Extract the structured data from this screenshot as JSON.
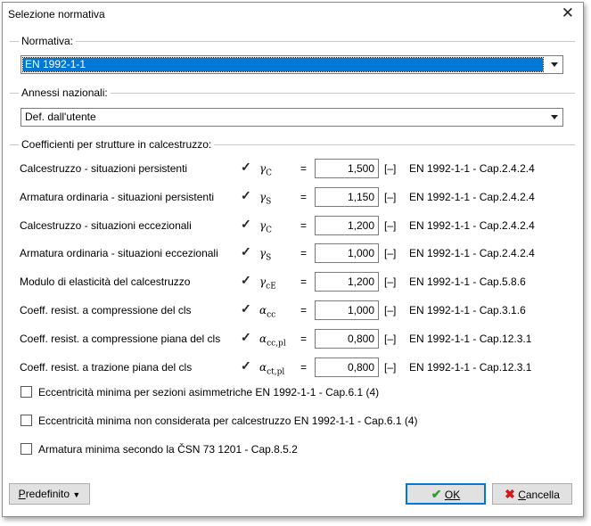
{
  "window": {
    "title": "Selezione normativa"
  },
  "normativa": {
    "label": "Normativa:",
    "value": "EN 1992-1-1"
  },
  "annessi": {
    "label": "Annessi nazionali:",
    "value": "Def. dall'utente"
  },
  "coeff": {
    "label": "Coefficienti per strutture in calcestruzzo:",
    "rows": [
      {
        "name": "Calcestruzzo - situazioni persistenti",
        "checked": true,
        "symbol": "γ",
        "sub": "C",
        "eq": "=",
        "value": "1,500",
        "unit": "[–]",
        "ref": "EN 1992-1-1 - Cap.2.4.2.4"
      },
      {
        "name": "Armatura ordinaria - situazioni persistenti",
        "checked": true,
        "symbol": "γ",
        "sub": "S",
        "eq": "=",
        "value": "1,150",
        "unit": "[–]",
        "ref": "EN 1992-1-1 - Cap.2.4.2.4"
      },
      {
        "name": "Calcestruzzo - situazioni eccezionali",
        "checked": true,
        "symbol": "γ",
        "sub": "C",
        "eq": "=",
        "value": "1,200",
        "unit": "[–]",
        "ref": "EN 1992-1-1 - Cap.2.4.2.4"
      },
      {
        "name": "Armatura ordinaria - situazioni eccezionali",
        "checked": true,
        "symbol": "γ",
        "sub": "S",
        "eq": "=",
        "value": "1,000",
        "unit": "[–]",
        "ref": "EN 1992-1-1 - Cap.2.4.2.4"
      },
      {
        "name": "Modulo di elasticità del calcestruzzo",
        "checked": true,
        "symbol": "γ",
        "sub": "cE",
        "eq": "=",
        "value": "1,200",
        "unit": "[–]",
        "ref": "EN 1992-1-1 - Cap.5.8.6"
      },
      {
        "name": "Coeff. resist. a compressione del cls",
        "checked": true,
        "symbol": "α",
        "sub": "cc",
        "eq": "=",
        "value": "1,000",
        "unit": "[–]",
        "ref": "EN 1992-1-1 - Cap.3.1.6"
      },
      {
        "name": "Coeff. resist. a compressione piana del cls",
        "checked": true,
        "symbol": "α",
        "sub": "cc,pl",
        "eq": "=",
        "value": "0,800",
        "unit": "[–]",
        "ref": "EN 1992-1-1 - Cap.12.3.1"
      },
      {
        "name": "Coeff. resist. a trazione piana del cls",
        "checked": true,
        "symbol": "α",
        "sub": "ct,pl",
        "eq": "=",
        "value": "0,800",
        "unit": "[–]",
        "ref": "EN 1992-1-1 - Cap.12.3.1"
      }
    ]
  },
  "options": [
    {
      "label": "Eccentricità minima per sezioni asimmetriche EN 1992-1-1 - Cap.6.1 (4)",
      "checked": false
    },
    {
      "label": "Eccentricità minima non considerata per calcestruzzo EN 1992-1-1 - Cap.6.1 (4)",
      "checked": false
    },
    {
      "label": "Armatura minima secondo la ČSN 73 1201 - Cap.8.5.2",
      "checked": false
    }
  ],
  "buttons": {
    "default_label": "Predefinito",
    "ok_label": "OK",
    "cancel_label": "Cancella",
    "ok_color": "#2e9e2e",
    "cancel_color": "#d01818"
  }
}
